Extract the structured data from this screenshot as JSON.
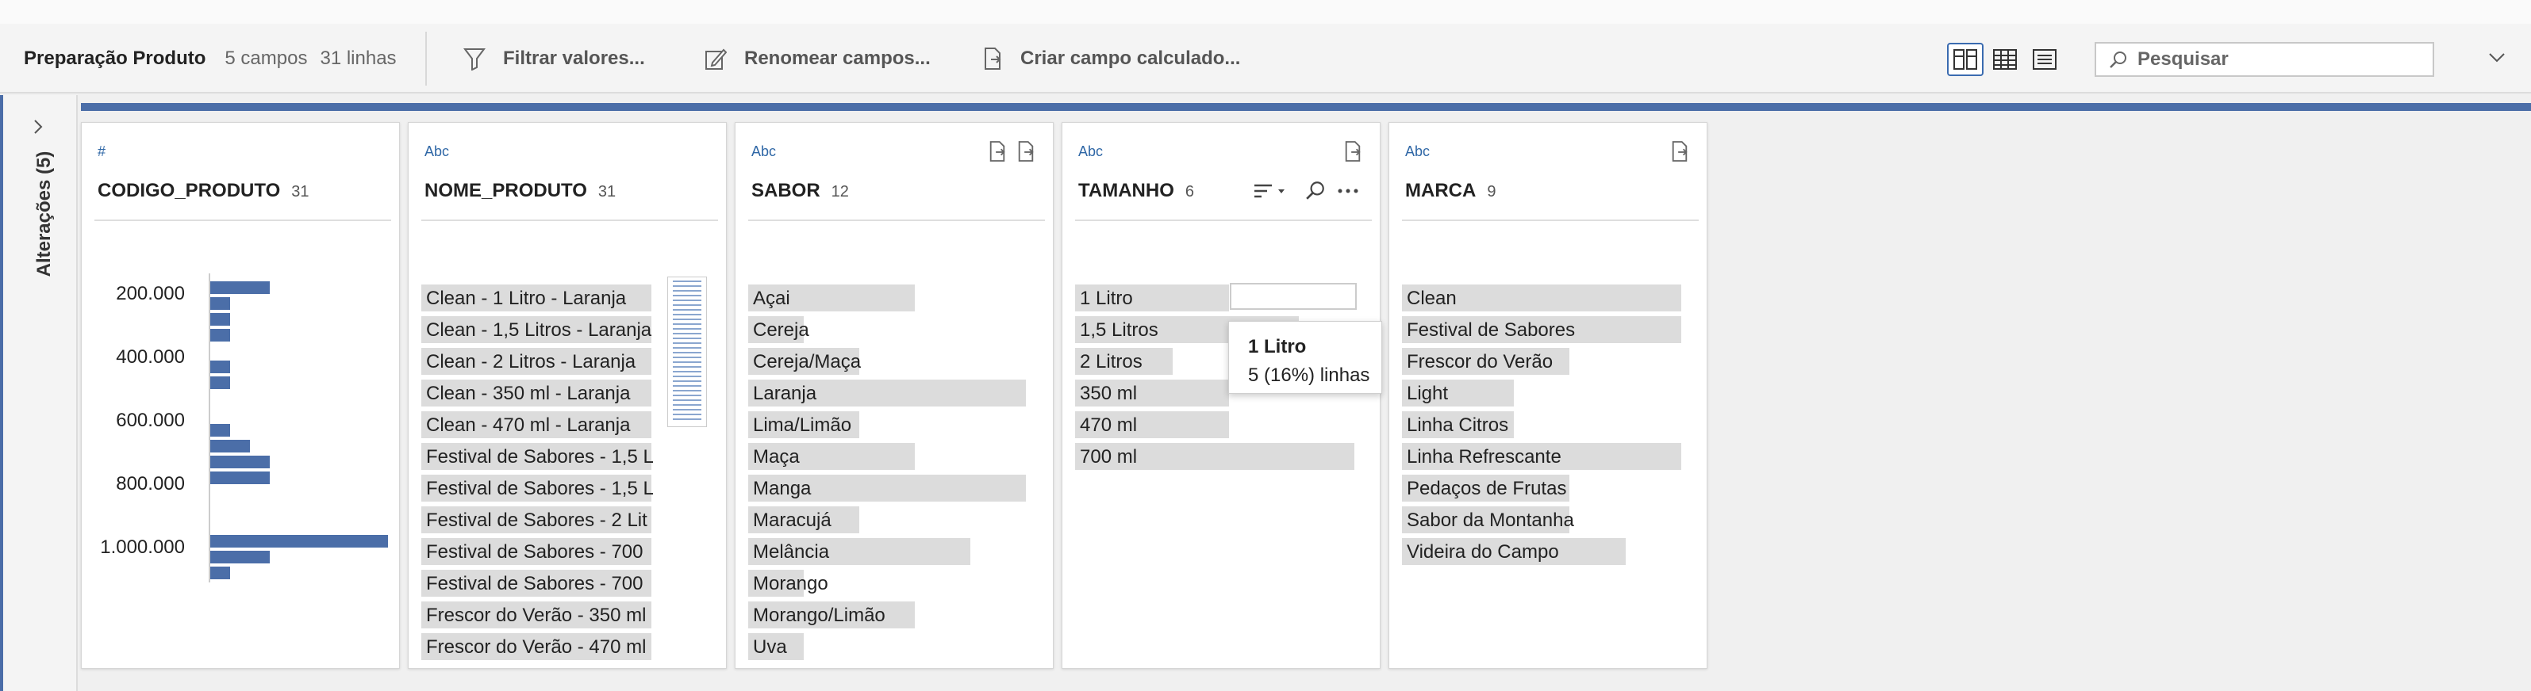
{
  "toolbar": {
    "title": "Preparação Produto",
    "fields_count": "5 campos",
    "rows_count": "31 linhas",
    "filter_label": "Filtrar valores...",
    "rename_label": "Renomear campos...",
    "calc_label": "Criar campo calculado...",
    "search_placeholder": "Pesquisar"
  },
  "sidebar": {
    "changes_label": "Alterações (5)"
  },
  "fields": [
    {
      "type": "#",
      "name": "CODIGO_PRODUTO",
      "count": "31"
    },
    {
      "type": "Abc",
      "name": "NOME_PRODUTO",
      "count": "31",
      "values": [
        "Clean - 1 Litro - Laranja",
        "Clean - 1,5 Litros - Laranja",
        "Clean - 2 Litros - Laranja",
        "Clean - 350 ml - Laranja",
        "Clean - 470 ml - Laranja",
        "Festival de Sabores - 1,5 L",
        "Festival de Sabores - 1,5 L",
        "Festival de Sabores - 2 Lit",
        "Festival de Sabores - 700",
        "Festival de Sabores - 700",
        "Frescor do Verão - 350 ml",
        "Frescor do Verão - 470 ml"
      ]
    },
    {
      "type": "Abc",
      "name": "SABOR",
      "count": "12",
      "values": [
        "Açai",
        "Cereja",
        "Cereja/Maça",
        "Laranja",
        "Lima/Limão",
        "Maça",
        "Manga",
        "Maracujá",
        "Melância",
        "Morango",
        "Morango/Limão",
        "Uva"
      ],
      "shares": [
        0.6,
        0.2,
        0.4,
        1.0,
        0.4,
        0.6,
        1.0,
        0.4,
        0.8,
        0.2,
        0.6,
        0.2
      ]
    },
    {
      "type": "Abc",
      "name": "TAMANHO",
      "count": "6",
      "values": [
        "1 Litro",
        "1,5 Litros",
        "2 Litros",
        "350 ml",
        "470 ml",
        "700 ml"
      ],
      "shares": [
        0.55,
        0.8,
        0.35,
        0.55,
        0.55,
        1.0
      ]
    },
    {
      "type": "Abc",
      "name": "MARCA",
      "count": "9",
      "values": [
        "Clean",
        "Festival de Sabores",
        "Frescor do Verão",
        "Light",
        "Linha Citros",
        "Linha Refrescante",
        "Pedaços de Frutas",
        "Sabor da Montanha",
        "Videira do Campo"
      ],
      "shares": [
        1.0,
        1.0,
        0.6,
        0.4,
        0.4,
        1.0,
        0.6,
        0.6,
        0.8
      ]
    }
  ],
  "histogram": {
    "tick_labels": [
      "200.000",
      "400.000",
      "600.000",
      "800.000",
      "1.000.000"
    ],
    "bin_counts": [
      3,
      1,
      1,
      1,
      0,
      1,
      1,
      0,
      0,
      1,
      2,
      3,
      3,
      0,
      0,
      0,
      9,
      3,
      1
    ]
  },
  "tooltip": {
    "title": "1 Litro",
    "detail": "5 (16%) linhas"
  }
}
